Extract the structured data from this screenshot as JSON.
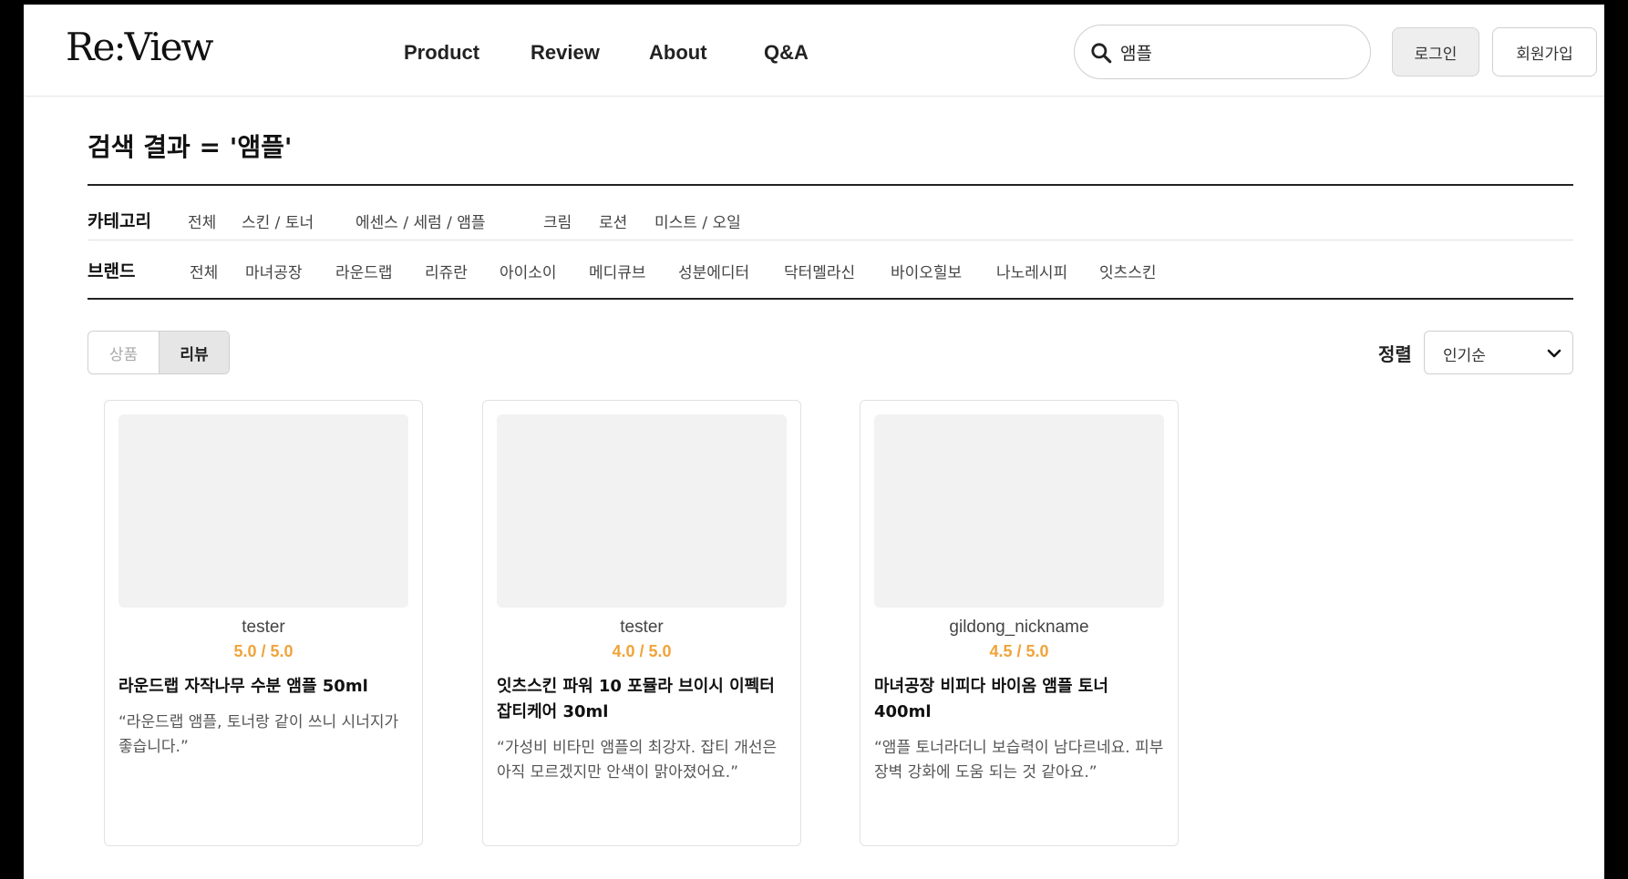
{
  "header": {
    "logo": "Re:View",
    "nav": [
      "Product",
      "Review",
      "About",
      "Q&A"
    ],
    "search_value": "앰플",
    "login_label": "로그인",
    "join_label": "회원가입"
  },
  "title": "검색 결과 = '앰플'",
  "filters": {
    "category": {
      "label": "카테고리",
      "options": [
        "전체",
        "스킨 / 토너",
        "에센스 / 세럼 / 앰플",
        "크림",
        "로션",
        "미스트 / 오일"
      ]
    },
    "brand": {
      "label": "브랜드",
      "options": [
        "전체",
        "마녀공장",
        "라운드랩",
        "리쥬란",
        "아이소이",
        "메디큐브",
        "성분에디터",
        "닥터멜라신",
        "바이오힐보",
        "나노레시피",
        "잇츠스킨"
      ]
    }
  },
  "view_toggle": {
    "product_label": "상품",
    "review_label": "리뷰",
    "selected": "리뷰"
  },
  "sort": {
    "label": "정렬",
    "value": "인기순"
  },
  "reviews": [
    {
      "user": "tester",
      "rating": "5.0 / 5.0",
      "title": "라운드랩 자작나무 수분 앰플 50ml",
      "text": "“라운드랩 앰플, 토너랑 같이 쓰니 시너지가 좋습니다.”"
    },
    {
      "user": "tester",
      "rating": "4.0 / 5.0",
      "title": "잇츠스킨 파워 10 포뮬라 브이시 이펙터 잡티케어 30ml",
      "text": "“가성비 비타민 앰플의 최강자. 잡티 개선은 아직 모르겠지만 안색이 맑아졌어요.”"
    },
    {
      "user": "gildong_nickname",
      "rating": "4.5 / 5.0",
      "title": "마녀공장 비피다 바이옴 앰플 토너 400ml",
      "text": "“앰플 토너라더니 보습력이 남다르네요. 피부 장벽 강화에 도움 되는 것 같아요.”"
    }
  ],
  "colors": {
    "rating": "#f0a33a",
    "rule": "#222222",
    "thumb": "#f2f2f2"
  }
}
